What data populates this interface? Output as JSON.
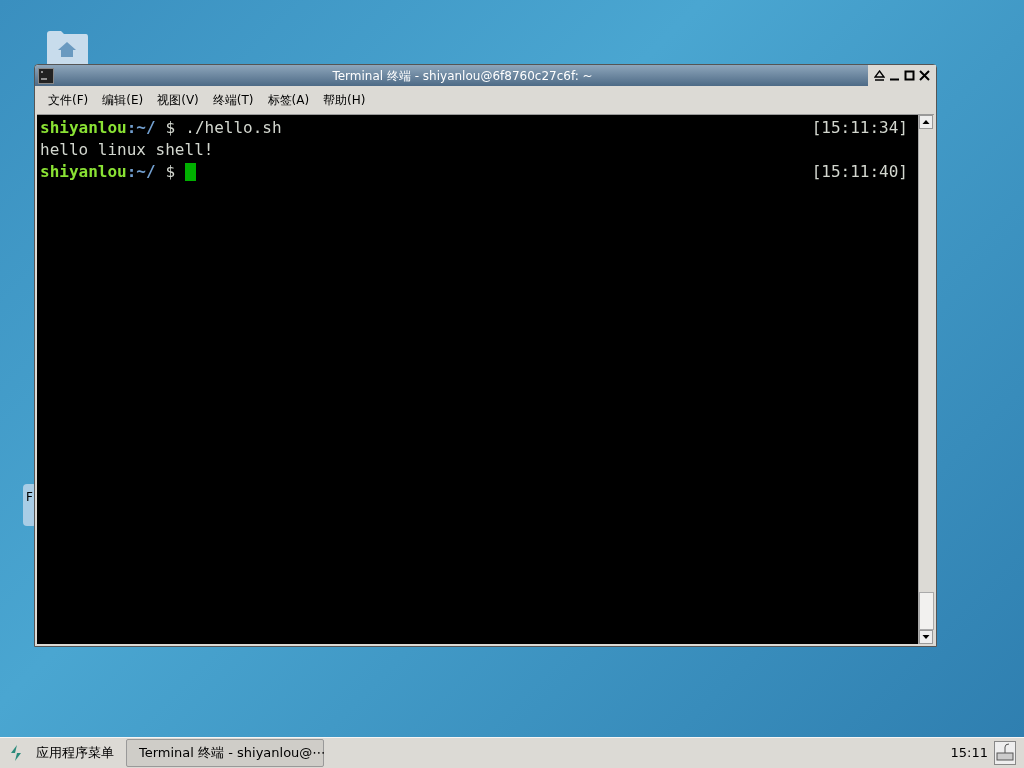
{
  "desktop": {
    "side_label": "F"
  },
  "window": {
    "title": "Terminal 终端 - shiyanlou@6f8760c27c6f: ~"
  },
  "menu": [
    "文件(F)",
    "编辑(E)",
    "视图(V)",
    "终端(T)",
    "标签(A)",
    "帮助(H)"
  ],
  "terminal": {
    "lines": [
      {
        "kind": "prompt",
        "user": "shiyanlou",
        "path": ":~/",
        "symbol": "$",
        "command": "./hello.sh",
        "time": "[15:11:34]",
        "cursor": false
      },
      {
        "kind": "output",
        "text": "hello linux shell!"
      },
      {
        "kind": "prompt",
        "user": "shiyanlou",
        "path": ":~/",
        "symbol": "$",
        "time": "[15:11:40]",
        "cursor": true
      }
    ]
  },
  "taskbar": {
    "menu_label": "应用程序菜单",
    "task": "Terminal 终端 - shiyanlou@⋯",
    "clock": "15:11"
  }
}
